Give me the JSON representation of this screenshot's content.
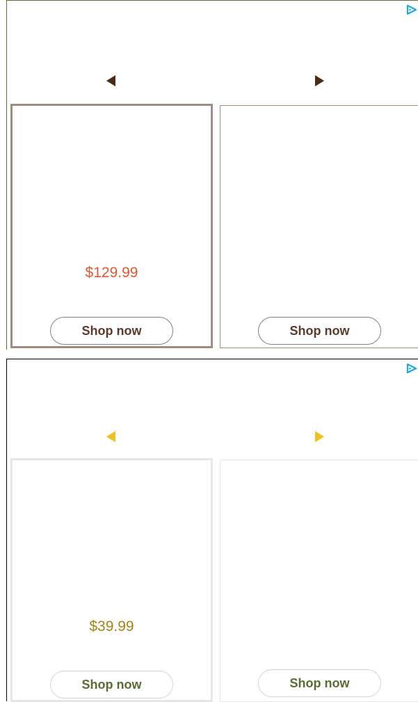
{
  "ads": [
    {
      "theme": {
        "arrow_color": "#4a2a1a",
        "price_color": "#e3572f",
        "card_border": "#a08b80",
        "button_border": "#8a7d75",
        "button_text": "#5a3a2a"
      },
      "products": [
        {
          "price": "$129.99",
          "cta": "Shop now"
        },
        {
          "price": "",
          "cta": "Shop now"
        }
      ]
    },
    {
      "theme": {
        "arrow_color": "#f0c020",
        "price_color": "#a08418",
        "card_border": "#e6e6e6",
        "button_border": "#d4d4d4",
        "button_text": "#5a6b32"
      },
      "products": [
        {
          "price": "$39.99",
          "cta": "Shop now"
        },
        {
          "price": "",
          "cta": "Shop now"
        }
      ]
    }
  ],
  "icons": {
    "ad_choices": "adchoices-icon",
    "prev": "arrow-left-icon",
    "next": "arrow-right-icon"
  }
}
